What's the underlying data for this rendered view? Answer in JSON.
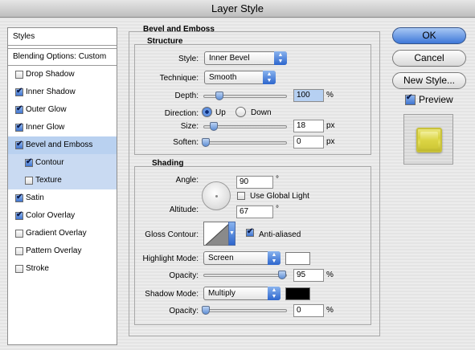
{
  "window": {
    "title": "Layer Style"
  },
  "sidebar": {
    "styles_header": "Styles",
    "blending_header": "Blending Options: Custom",
    "items": [
      {
        "label": "Drop Shadow",
        "checked": false
      },
      {
        "label": "Inner Shadow",
        "checked": true
      },
      {
        "label": "Outer Glow",
        "checked": true
      },
      {
        "label": "Inner Glow",
        "checked": true
      },
      {
        "label": "Bevel and Emboss",
        "checked": true,
        "selected": true
      },
      {
        "label": "Contour",
        "checked": true,
        "sub": true
      },
      {
        "label": "Texture",
        "checked": false,
        "sub": true
      },
      {
        "label": "Satin",
        "checked": true
      },
      {
        "label": "Color Overlay",
        "checked": true
      },
      {
        "label": "Gradient Overlay",
        "checked": false
      },
      {
        "label": "Pattern Overlay",
        "checked": false
      },
      {
        "label": "Stroke",
        "checked": false
      }
    ]
  },
  "bevel": {
    "title": "Bevel and Emboss",
    "structure": {
      "title": "Structure",
      "style_label": "Style:",
      "style_value": "Inner Bevel",
      "technique_label": "Technique:",
      "technique_value": "Smooth",
      "depth_label": "Depth:",
      "depth_value": "100",
      "depth_unit": "%",
      "direction_label": "Direction:",
      "dir_up": "Up",
      "dir_down": "Down",
      "size_label": "Size:",
      "size_value": "18",
      "size_unit": "px",
      "soften_label": "Soften:",
      "soften_value": "0",
      "soften_unit": "px"
    },
    "shading": {
      "title": "Shading",
      "angle_label": "Angle:",
      "angle_value": "90",
      "angle_unit": "°",
      "global_light_label": "Use Global Light",
      "altitude_label": "Altitude:",
      "altitude_value": "67",
      "altitude_unit": "°",
      "gloss_label": "Gloss Contour:",
      "anti_aliased_label": "Anti-aliased",
      "highlight_mode_label": "Highlight Mode:",
      "highlight_mode_value": "Screen",
      "highlight_color": "#ffffff",
      "opacity1_label": "Opacity:",
      "opacity1_value": "95",
      "opacity1_unit": "%",
      "shadow_mode_label": "Shadow Mode:",
      "shadow_mode_value": "Multiply",
      "shadow_color": "#000000",
      "opacity2_label": "Opacity:",
      "opacity2_value": "0",
      "opacity2_unit": "%"
    }
  },
  "buttons": {
    "ok": "OK",
    "cancel": "Cancel",
    "new_style": "New Style...",
    "preview": "Preview"
  }
}
